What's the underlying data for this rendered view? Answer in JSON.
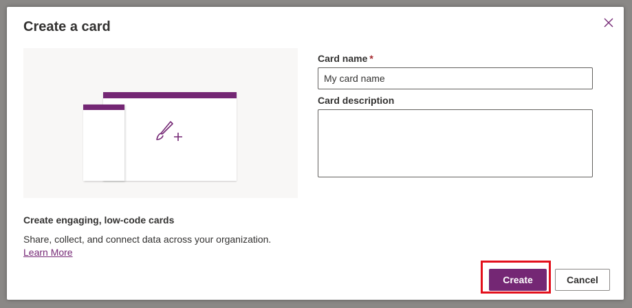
{
  "dialog": {
    "title": "Create a card",
    "close_icon": "close-icon"
  },
  "illustration": {
    "icon": "paintbrush-plus-icon",
    "accent_color": "#742774"
  },
  "info": {
    "tagline": "Create engaging, low-code cards",
    "description": "Share, collect, and connect data across your organization.",
    "link_text": "Learn More"
  },
  "form": {
    "card_name_label": "Card name",
    "required_marker": "*",
    "card_name_value": "My card name",
    "card_description_label": "Card description",
    "card_description_value": ""
  },
  "actions": {
    "create_label": "Create",
    "cancel_label": "Cancel"
  },
  "colors": {
    "brand": "#742774",
    "highlight": "#e3101c"
  }
}
